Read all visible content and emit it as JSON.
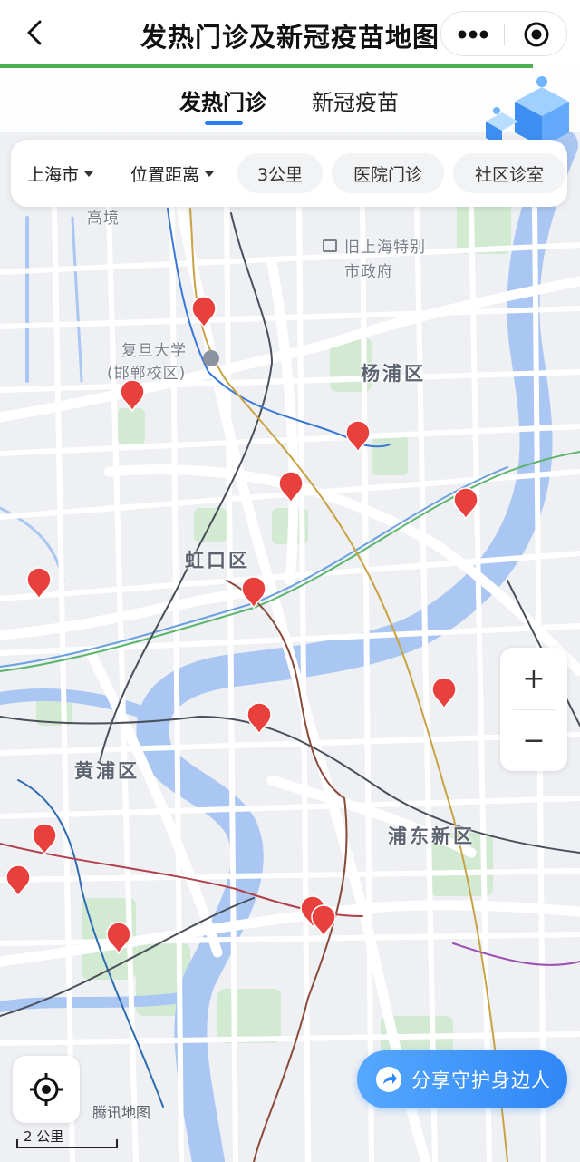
{
  "nav": {
    "title": "发热门诊及新冠疫苗地图"
  },
  "tabs": [
    {
      "label": "发热门诊",
      "active": true
    },
    {
      "label": "新冠疫苗",
      "active": false
    }
  ],
  "filters": {
    "city": "上海市",
    "sort": "位置距离",
    "chips": [
      "3公里",
      "医院门诊",
      "社区诊室"
    ]
  },
  "map": {
    "labels": {
      "gaojing": "高境",
      "old_gov_line1": "旧上海特别",
      "old_gov_line2": "市政府",
      "fudan_line1": "复旦大学",
      "fudan_line2": "(邯郸校区)",
      "yangpu": "杨浦区",
      "hongkou": "虹口区",
      "huangpu": "黄浦区",
      "pudong": "浦东新区"
    },
    "credit": "腾讯地图",
    "scale": "2 公里",
    "marker_count": 16
  },
  "controls": {
    "zoom_in": "+",
    "zoom_out": "−",
    "share": "分享守护身边人"
  },
  "colors": {
    "accent": "#2b7df6",
    "progress": "#4cb050",
    "marker": "#e8403d",
    "water": "#aac6f2",
    "land": "#eef0f3"
  }
}
